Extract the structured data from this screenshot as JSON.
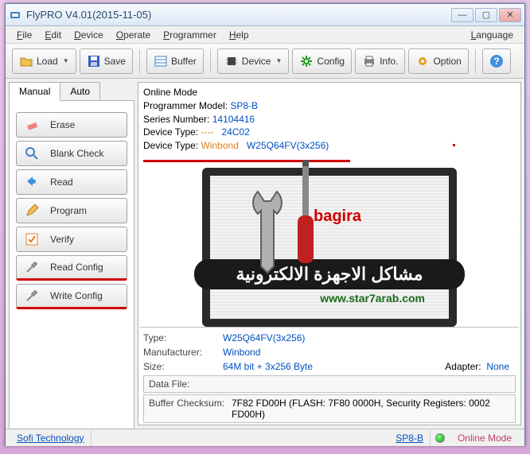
{
  "window": {
    "title": "FlyPRO V4.01(2015-11-05)"
  },
  "menu": {
    "file": "File",
    "edit": "Edit",
    "device": "Device",
    "operate": "Operate",
    "programmer": "Programmer",
    "help": "Help",
    "language": "Language"
  },
  "toolbar": {
    "load": "Load",
    "save": "Save",
    "buffer": "Buffer",
    "device": "Device",
    "config": "Config",
    "info": "Info.",
    "option": "Option"
  },
  "tabs": {
    "manual": "Manual",
    "auto": "Auto"
  },
  "actions": {
    "erase": "Erase",
    "blank": "Blank Check",
    "read": "Read",
    "program": "Program",
    "verify": "Verify",
    "readcfg": "Read Config",
    "writecfg": "Write Config"
  },
  "info": {
    "mode_label": "Online Mode",
    "prog_model_label": "Programmer Model:",
    "prog_model": "SP8-B",
    "series_label": "Series Number:",
    "series": "14104416",
    "devtype1_label": "Device Type:",
    "devtype1_dash": "----",
    "devtype1": "24C02",
    "devtype2_label": "Device Type:",
    "devtype2_mfr": "Winbond",
    "devtype2_part": "W25Q64FV(3x256)"
  },
  "banner": {
    "bagira": "bagira",
    "arabic": "مشاكل الاجهزة الالكترونية",
    "url": "www.star7arab.com"
  },
  "bottom": {
    "type_label": "Type:",
    "type": "W25Q64FV(3x256)",
    "mfr_label": "Manufacturer:",
    "mfr": "Winbond",
    "size_label": "Size:",
    "size": "64M bit + 3x256 Byte",
    "adapter_label": "Adapter:",
    "adapter": "None",
    "datafile_label": "Data File:",
    "datafile": "",
    "checksum_label": "Buffer Checksum:",
    "checksum": "7F82 FD00H (FLASH: 7F80 0000H, Security Registers: 0002 FD00H)"
  },
  "status": {
    "company": "Sofi Technology",
    "device": "SP8-B",
    "mode": "Online Mode"
  }
}
